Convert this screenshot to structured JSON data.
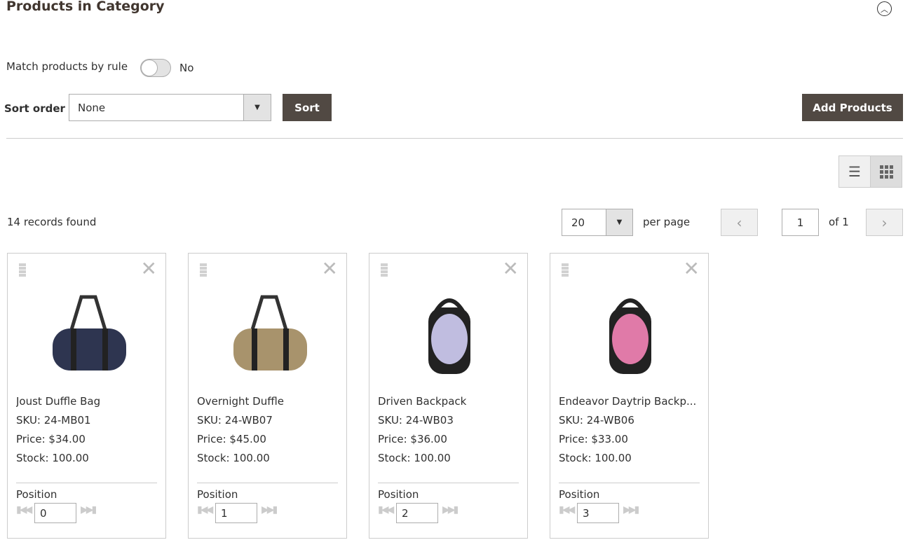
{
  "header": {
    "title": "Products in Category"
  },
  "match": {
    "label": "Match products by rule",
    "value": "No",
    "enabled": false
  },
  "sort": {
    "label": "Sort order",
    "selected": "None",
    "button": "Sort"
  },
  "add_products": "Add Products",
  "view": {
    "modes": [
      "list",
      "grid"
    ],
    "active": "grid"
  },
  "records": "14 records found",
  "pager": {
    "per_page": "20",
    "per_page_label": "per page",
    "page": "1",
    "of": "of 1"
  },
  "products": [
    {
      "name": "Joust Duffle Bag",
      "sku": "SKU: 24-MB01",
      "price": "Price: $34.00",
      "stock": "Stock: 100.00",
      "position_label": "Position",
      "position": "0",
      "color": "#2e3550"
    },
    {
      "name": "Overnight Duffle",
      "sku": "SKU: 24-WB07",
      "price": "Price: $45.00",
      "stock": "Stock: 100.00",
      "position_label": "Position",
      "position": "1",
      "color": "#a8936c"
    },
    {
      "name": "Driven Backpack",
      "sku": "SKU: 24-WB03",
      "price": "Price: $36.00",
      "stock": "Stock: 100.00",
      "position_label": "Position",
      "position": "2",
      "color": "#c0bde0"
    },
    {
      "name": "Endeavor Daytrip Backp...",
      "sku": "SKU: 24-WB06",
      "price": "Price: $33.00",
      "stock": "Stock: 100.00",
      "position_label": "Position",
      "position": "3",
      "color": "#e07aa8"
    }
  ]
}
